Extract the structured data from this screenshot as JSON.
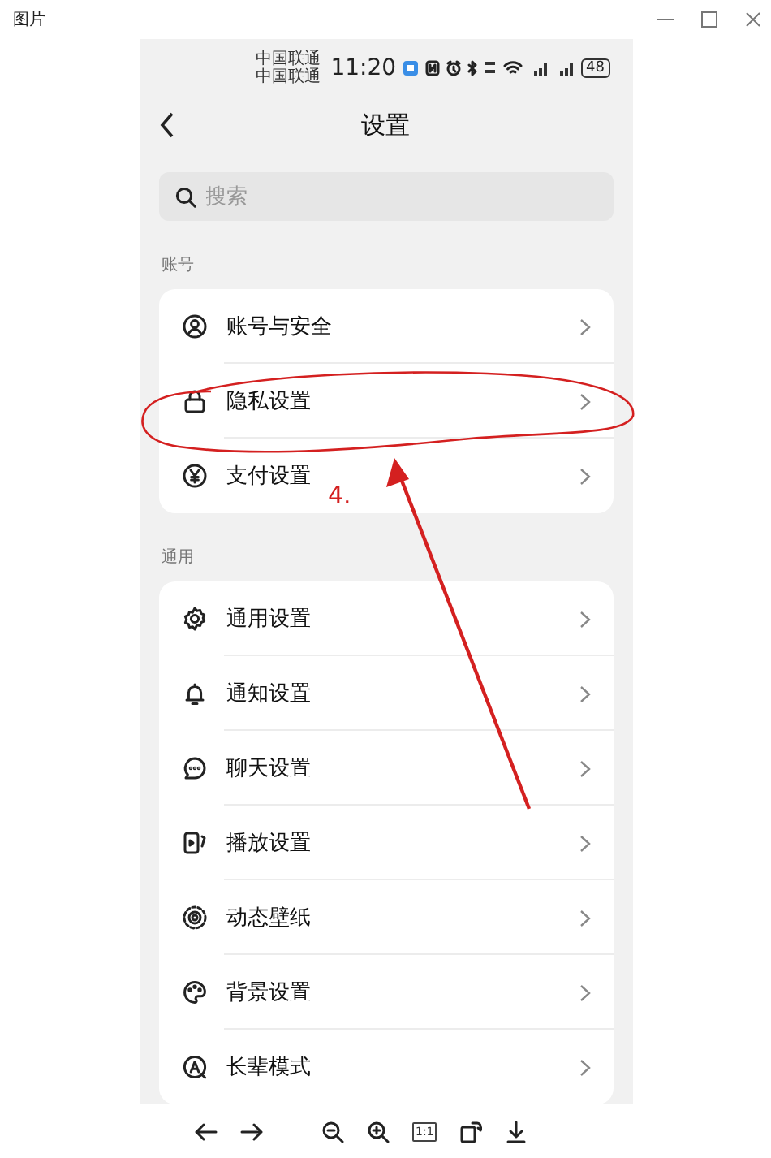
{
  "window": {
    "title": "图片"
  },
  "status_bar": {
    "carriers": [
      "中国联通",
      "中国联通"
    ],
    "time": "11:20",
    "battery": "48"
  },
  "header": {
    "title": "设置"
  },
  "search": {
    "placeholder": "搜索"
  },
  "sections": [
    {
      "title": "账号",
      "items": [
        {
          "label": "账号与安全"
        },
        {
          "label": "隐私设置"
        },
        {
          "label": "支付设置"
        }
      ]
    },
    {
      "title": "通用",
      "items": [
        {
          "label": "通用设置"
        },
        {
          "label": "通知设置"
        },
        {
          "label": "聊天设置"
        },
        {
          "label": "播放设置"
        },
        {
          "label": "动态壁纸"
        },
        {
          "label": "背景设置"
        },
        {
          "label": "长辈模式"
        }
      ]
    }
  ],
  "annotation": {
    "label": "4."
  },
  "toolbar": {
    "actual_size": "1:1"
  }
}
